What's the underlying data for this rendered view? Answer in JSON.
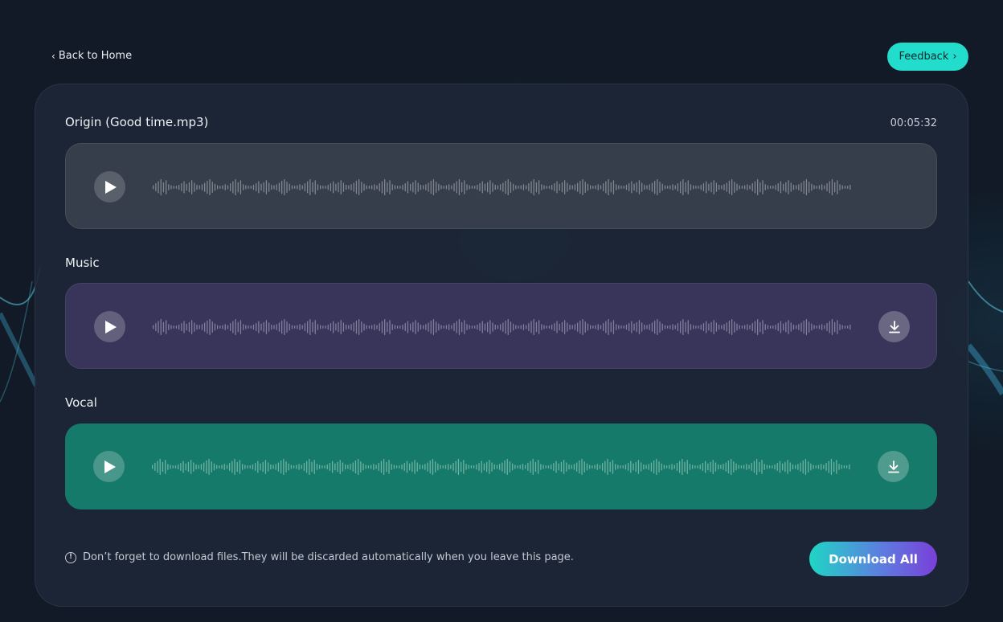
{
  "nav": {
    "back_label": "Back to Home",
    "feedback_label": "Feedback"
  },
  "origin": {
    "title": "Origin (Good time.mp3)",
    "duration": "00:05:32"
  },
  "tracks": [
    {
      "title": "Music"
    },
    {
      "title": "Vocal"
    }
  ],
  "footer": {
    "notice": "Don’t forget to download files.They will be discarded automatically when you leave this page.",
    "download_all_label": "Download All"
  },
  "colors": {
    "accent": "#22dccc",
    "origin_card": "#353e4a",
    "music_card": "#38345a",
    "vocal_card": "#157a69"
  }
}
